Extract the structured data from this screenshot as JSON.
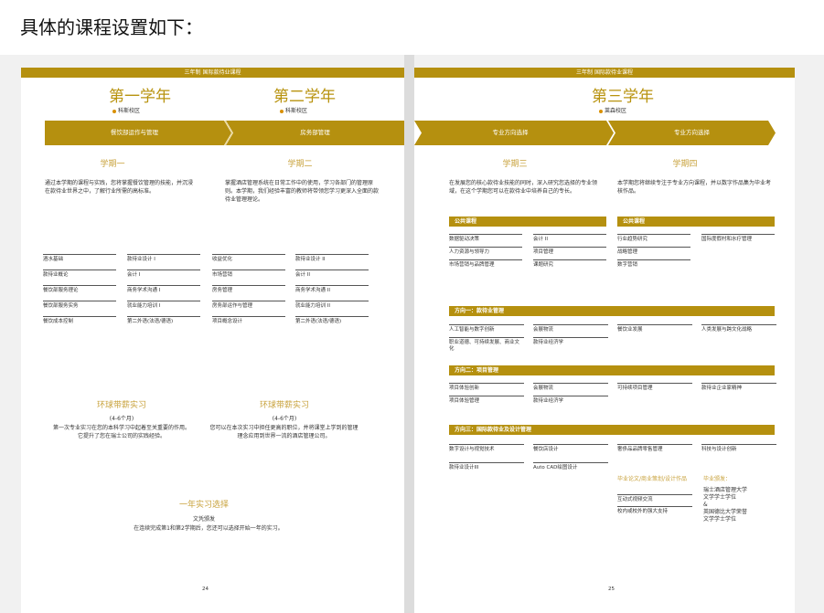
{
  "heading": "具体的课程设置如下：",
  "left_page": {
    "topbar": "三年制 国际款待业课程",
    "year1": {
      "title": "第一学年",
      "campus": "科斯校区",
      "band": "餐饮部运作与管理"
    },
    "year2": {
      "title": "第二学年",
      "campus": "科斯校区",
      "band": "房务部管理"
    },
    "sem1": {
      "title": "学期一",
      "desc": "通过本学期的课程与实践，您将掌握餐饮管理的技能，并沉浸在款待业世界之中，了解行业所需的高标准。",
      "col1": [
        "酒水基础",
        "款待业概论",
        "餐饮部服务理论",
        "餐饮部服务实务",
        "餐饮成本控制"
      ],
      "col2": [
        "款待业设计 I",
        "会计 I",
        "商务学术沟通 I",
        "就业能力培训 I",
        "第二外语(法语/德语)"
      ]
    },
    "sem2": {
      "title": "学期二",
      "desc": "掌握酒店管理系统在日常工作中的使用，学习各部门的管理原则。本学期，我们经验丰富的教师将带领您学习更深入全面的款待业管理理论。",
      "col1": [
        "收益优化",
        "市场营销",
        "房务管理",
        "房务部运作与管理",
        "项目概念设计"
      ],
      "col2": [
        "款待业设计 II",
        "会计 II",
        "商务学术沟通 II",
        "就业能力培训 II",
        "第二外语(法语/德语)"
      ]
    },
    "intern1": {
      "title": "环球带薪实习",
      "months": "(4-6个月)",
      "desc": "第一次专业实习在您的本科学习中起着至关重要的作用。它提升了您在瑞士公司的实践经验。"
    },
    "intern2": {
      "title": "环球带薪实习",
      "months": "(4-6个月)",
      "desc": "您可以在本次实习中担任更高的职位，并将课堂上学到的管理理念应用到世界一流的酒店管理公司。"
    },
    "gap": {
      "title": "一年实习选择",
      "sub": "文凭颁发",
      "desc": "在连续完成第1和第2学期后，您还可以选择开始一年的实习。"
    },
    "page_number": "24"
  },
  "right_page": {
    "topbar": "三年制 国际款待业课程",
    "year3": {
      "title": "第三学年",
      "campus": "莱森校区"
    },
    "band1": "专业方向选择",
    "band2": "专业方向选择",
    "sem3": {
      "title": "学期三",
      "desc": "在发展您的核心款待业技能的同时，深入研究您选择的专业领域，在这个学期您可以在款待业中培养自己的专长。"
    },
    "sem4": {
      "title": "学期四",
      "desc": "本学期您将继续专注于专业方向课程，并以数字作品集为毕业考核作品。"
    },
    "common3": {
      "title": "公共课程",
      "col1": [
        "数据驱动决策",
        "人力资源与领导力",
        "市场营销与品牌管理"
      ],
      "col2": [
        "会计 II",
        "项目管理",
        "课题研究"
      ]
    },
    "common4": {
      "title": "公共课程",
      "col1": [
        "行业趋势研究",
        "战略管理",
        "数字营销"
      ],
      "col2": [
        "国际度假村和水疗管理"
      ]
    },
    "track1": {
      "title": "方向一：款待业管理",
      "items": [
        "人工智能与数字创新",
        "职业道德、可持续发展、商业文化",
        "会展物流",
        "款待业经济学",
        "餐饮业发展",
        "人类发展与跨文化战略"
      ]
    },
    "track2": {
      "title": "方向二：项目管理",
      "items": [
        "项目体验创新",
        "项目体验管理",
        "会展物流",
        "款待业经济学",
        "可持续项目管理",
        "款待业企业家精神"
      ]
    },
    "track3": {
      "title": "方向三：国际款待业及设计管理",
      "items": [
        "数字设计与视觉技术",
        "款待业设计III",
        "餐饮店设计",
        "Auto CAD绘图设计",
        "奢侈品品牌零售管理",
        "科技与设计创新"
      ]
    },
    "portfolio": {
      "title": "毕业论文/商业策划/设计作品",
      "items": [
        "互动式视频交流",
        "校内或校外的强大支持"
      ]
    },
    "degree": {
      "title": "毕业颁发：",
      "items": [
        "瑞士酒店管理大学",
        "文学学士学位",
        "&",
        "英国德比大学荣誉",
        "文学学士学位"
      ]
    },
    "page_number": "25"
  }
}
